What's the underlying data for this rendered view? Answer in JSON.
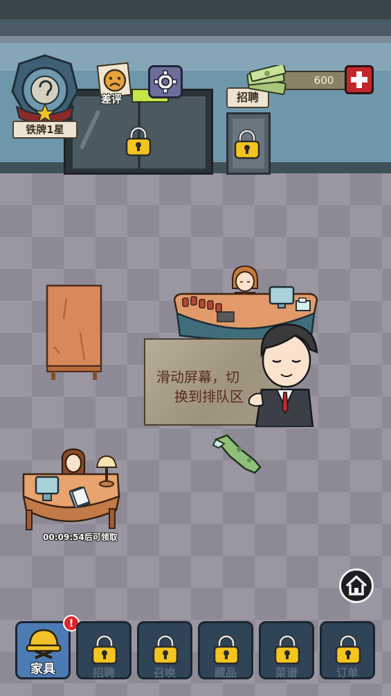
{
  "rank": {
    "label": "铁牌1星"
  },
  "bad_review": {
    "label": "差评"
  },
  "currency": {
    "amount": "600"
  },
  "recruit_sign": {
    "label": "招聘"
  },
  "dialog": {
    "text_line1": "滑动屏幕，切",
    "text_line2": "换到排队区"
  },
  "timer": {
    "text": "00:09:54后可领取"
  },
  "bottom_nav": {
    "items": [
      {
        "label": "家具",
        "locked": false,
        "badge": "!"
      },
      {
        "label": "招聘",
        "locked": true
      },
      {
        "label": "召唤",
        "locked": true
      },
      {
        "label": "藏品",
        "locked": true
      },
      {
        "label": "菜谱",
        "locked": true
      },
      {
        "label": "订单",
        "locked": true
      }
    ]
  },
  "colors": {
    "accent_red": "#c0272d",
    "badge_red": "#e0262b",
    "gold": "#f3c22b"
  }
}
